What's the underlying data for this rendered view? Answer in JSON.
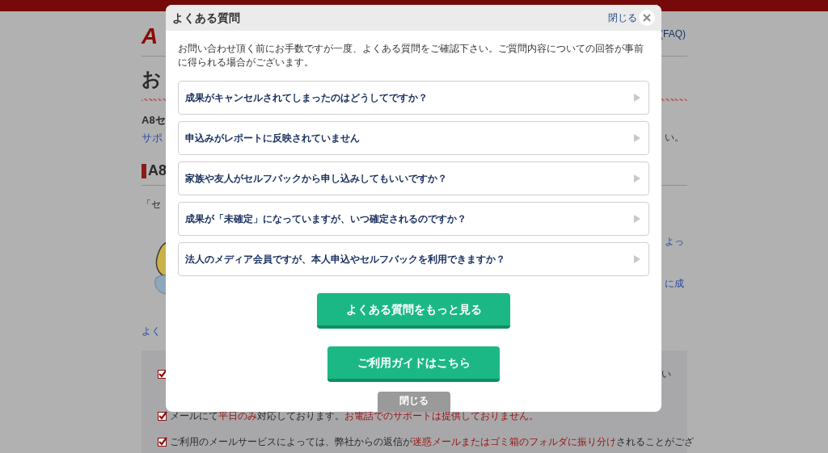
{
  "background_page": {
    "logo": "A",
    "header_link": "(FAQ)",
    "title": "お",
    "intro_bold": "A8セ",
    "intro_link": "サポ",
    "intro_tail": "い。",
    "section_heading": "A8",
    "section_text": "「セ",
    "side_links": [
      "よっ",
      "に成"
    ],
    "faq_link": "よく",
    "notices": [
      {
        "kind": "tail",
        "segments": [
          {
            "text": "い",
            "highlight": false
          }
        ]
      },
      {
        "kind": "full",
        "segments": [
          {
            "text": "メールにて",
            "highlight": false
          },
          {
            "text": "平日のみ",
            "highlight": true
          },
          {
            "text": "対応しております。",
            "highlight": false
          },
          {
            "text": "お電話でのサポートは提供しておりません。",
            "highlight": true
          }
        ]
      },
      {
        "kind": "full",
        "segments": [
          {
            "text": "ご利用のメールサービスによっては、弊社からの返信が",
            "highlight": false
          },
          {
            "text": "迷惑メールまたはゴミ箱のフォルダに振り分け",
            "highlight": true
          },
          {
            "text": "されることがござ",
            "highlight": false
          }
        ]
      }
    ]
  },
  "modal": {
    "title": "よくある質問",
    "close_link": "閉じる",
    "intro": "お問い合わせ頂く前にお手数ですが一度、よくある質問をご確認下さい。ご質問内容についての回答が事前に得られる場合がございます。",
    "questions": [
      "成果がキャンセルされてしまったのはどうしてですか？",
      "申込みがレポートに反映されていません",
      "家族や友人がセルフバックから申し込みしてもいいですか？",
      "成果が「未確定」になっていますが、いつ確定されるのですか？",
      "法人のメディア会員ですが、本人申込やセルフバックを利用できますか？"
    ],
    "buttons": [
      {
        "label": "よくある質問をもっと見る"
      },
      {
        "label": "ご利用ガイドはこちら"
      }
    ],
    "footer_close": "閉じる"
  }
}
